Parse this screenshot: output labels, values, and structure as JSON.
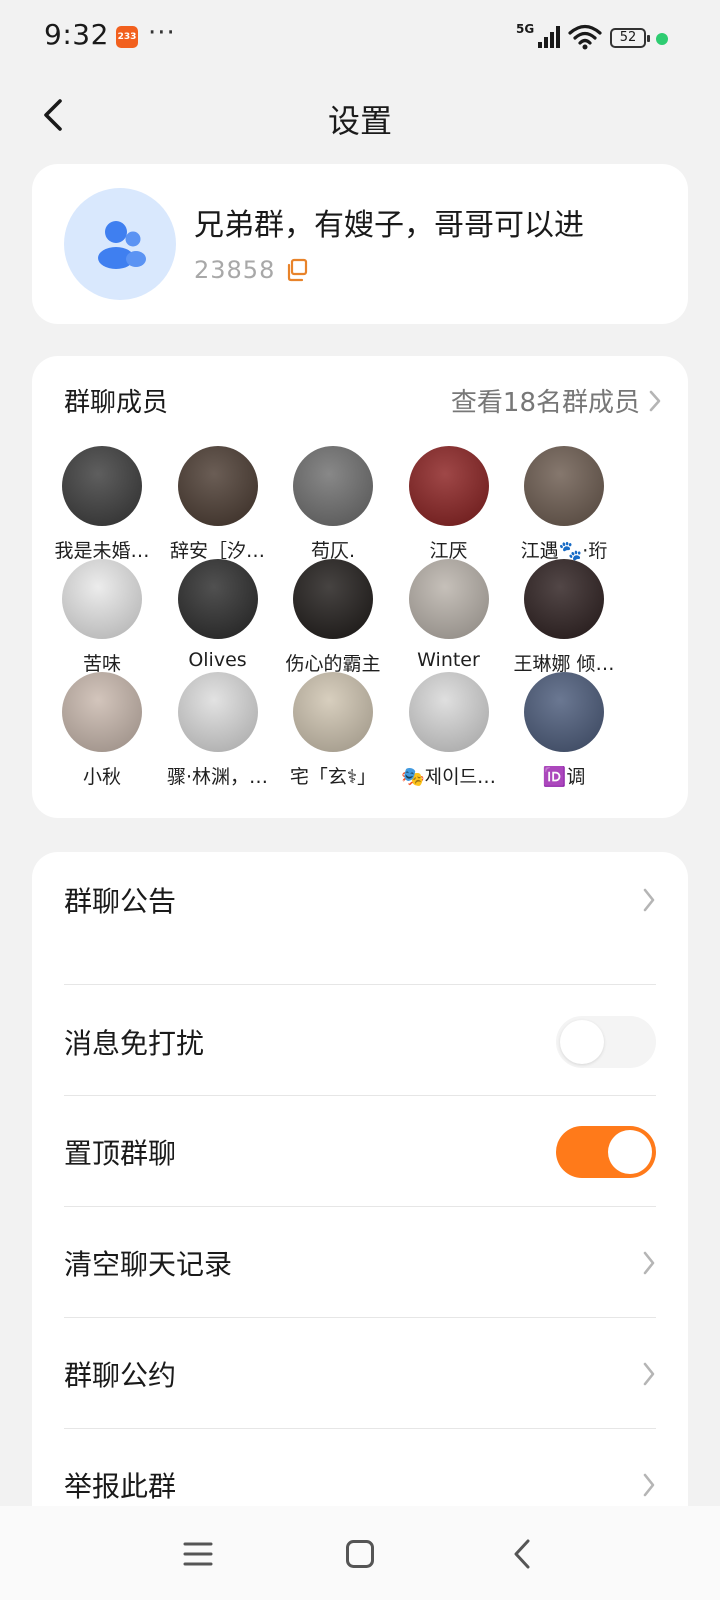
{
  "status": {
    "time": "9:32",
    "app_badge": "233",
    "dots": "···",
    "network": "5G",
    "battery": "52",
    "dot_color": "#2ecc71"
  },
  "header": {
    "title": "设置",
    "back_icon": "chevron-left-icon"
  },
  "group": {
    "name": "兄弟群，有嫂子，哥哥可以进",
    "id": "23858",
    "avatar_icon": "group-people-icon",
    "copy_icon": "copy-icon",
    "accent": "#e8832a"
  },
  "members": {
    "title": "群聊成员",
    "view_all": "查看18名群成员",
    "list": [
      {
        "name": "我是未婚…",
        "color": "#3b3b3b"
      },
      {
        "name": "辞安［汐…",
        "color": "#4a3a30"
      },
      {
        "name": "苟仄.",
        "color": "#6e6e6e"
      },
      {
        "name": "江厌",
        "color": "#8a1f1f"
      },
      {
        "name": "江遇🐾·珩",
        "color": "#6b5a4e"
      },
      {
        "name": "苦味",
        "color": "#e8e8e8"
      },
      {
        "name": "Olives",
        "color": "#2a2a2a"
      },
      {
        "name": "伤心的霸主",
        "color": "#1e1a18"
      },
      {
        "name": "Winter",
        "color": "#b9b2aa"
      },
      {
        "name": "王琳娜 倾…",
        "color": "#2c1e1e"
      },
      {
        "name": "小秋",
        "color": "#c9b8ad"
      },
      {
        "name": "骤·林渊，…",
        "color": "#dcdcdc"
      },
      {
        "name": "宅「玄⚕」",
        "color": "#cfc4b0"
      },
      {
        "name": "🎭제이드…",
        "color": "#d8d8d8"
      },
      {
        "name": "🆔调",
        "color": "#4a5a7a"
      }
    ]
  },
  "settings": {
    "items": [
      {
        "label": "群聊公告",
        "type": "arrow"
      },
      {
        "label": "消息免打扰",
        "type": "toggle",
        "on": false
      },
      {
        "label": "置顶群聊",
        "type": "toggle",
        "on": true
      },
      {
        "label": "清空聊天记录",
        "type": "arrow"
      },
      {
        "label": "群聊公约",
        "type": "arrow"
      },
      {
        "label": "举报此群",
        "type": "arrow"
      }
    ],
    "toggle_on_color": "#ff7a1a"
  },
  "nav": {
    "menu_icon": "menu-icon",
    "home_icon": "home-square-icon",
    "back_icon": "back-triangle-icon"
  }
}
